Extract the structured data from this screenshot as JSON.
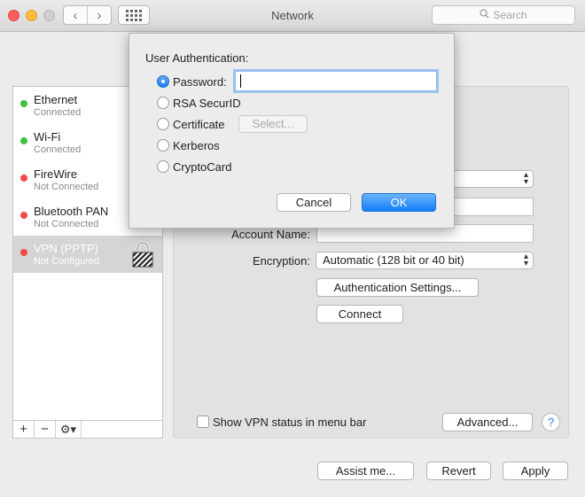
{
  "window": {
    "title": "Network"
  },
  "search": {
    "placeholder": "Search"
  },
  "sidebar": {
    "items": [
      {
        "name": "Ethernet",
        "status": "Connected",
        "color": "#3ec23f"
      },
      {
        "name": "Wi-Fi",
        "status": "Connected",
        "color": "#3ec23f"
      },
      {
        "name": "FireWire",
        "status": "Not Connected",
        "color": "#f04b47"
      },
      {
        "name": "Bluetooth PAN",
        "status": "Not Connected",
        "color": "#f04b47"
      },
      {
        "name": "VPN (PPTP)",
        "status": "Not Configured",
        "color": "#f04b47"
      }
    ],
    "footer": {
      "add": "+",
      "remove": "−",
      "gear": "⚙▾"
    }
  },
  "panel": {
    "account_name_label": "Account Name:",
    "encryption_label": "Encryption:",
    "encryption_value": "Automatic (128 bit or 40 bit)",
    "auth_settings_button": "Authentication Settings...",
    "connect_button": "Connect",
    "show_vpn_status_label": "Show VPN status in menu bar",
    "advanced_button": "Advanced...",
    "help_button": "?"
  },
  "footer": {
    "assist_button": "Assist me...",
    "revert_button": "Revert",
    "apply_button": "Apply"
  },
  "sheet": {
    "heading": "User Authentication:",
    "options": [
      {
        "label": "Password:",
        "selected": true
      },
      {
        "label": "RSA SecurID",
        "selected": false
      },
      {
        "label": "Certificate",
        "selected": false
      },
      {
        "label": "Kerberos",
        "selected": false
      },
      {
        "label": "CryptoCard",
        "selected": false
      }
    ],
    "password_value": "",
    "select_button": "Select...",
    "cancel_button": "Cancel",
    "ok_button": "OK"
  },
  "colors": {
    "accent": "#127ef9",
    "connected": "#3ec23f",
    "disconnected": "#f04b47"
  }
}
